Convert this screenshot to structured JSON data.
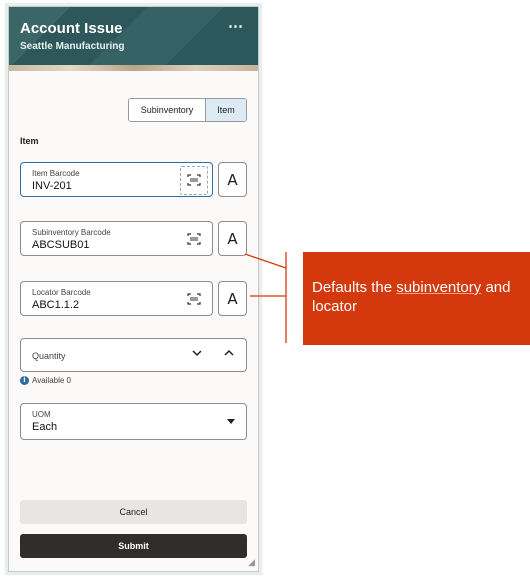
{
  "header": {
    "title": "Account Issue",
    "subtitle": "Seattle Manufacturing",
    "more_icon": "⋯"
  },
  "segment": {
    "options": [
      "Subinventory",
      "Item"
    ],
    "selected": "Item"
  },
  "section_label": "Item",
  "fields": {
    "item_barcode": {
      "label": "Item Barcode",
      "value": "INV-201"
    },
    "subinventory_barcode": {
      "label": "Subinventory Barcode",
      "value": "ABCSUB01"
    },
    "locator_barcode": {
      "label": "Locator Barcode",
      "value": "ABC1.1.2"
    }
  },
  "quantity": {
    "label": "Quantity",
    "available": "Available 0"
  },
  "uom": {
    "label": "UOM",
    "value": "Each"
  },
  "buttons": {
    "cancel": "Cancel",
    "submit": "Submit"
  },
  "callout": {
    "text_before": "Defaults the ",
    "text_underlined": "subinventory",
    "text_after": " and locator",
    "color": "#d4380d"
  },
  "icons": {
    "scan": "barcode-scan-icon",
    "text_entry": "text-entry-icon"
  }
}
